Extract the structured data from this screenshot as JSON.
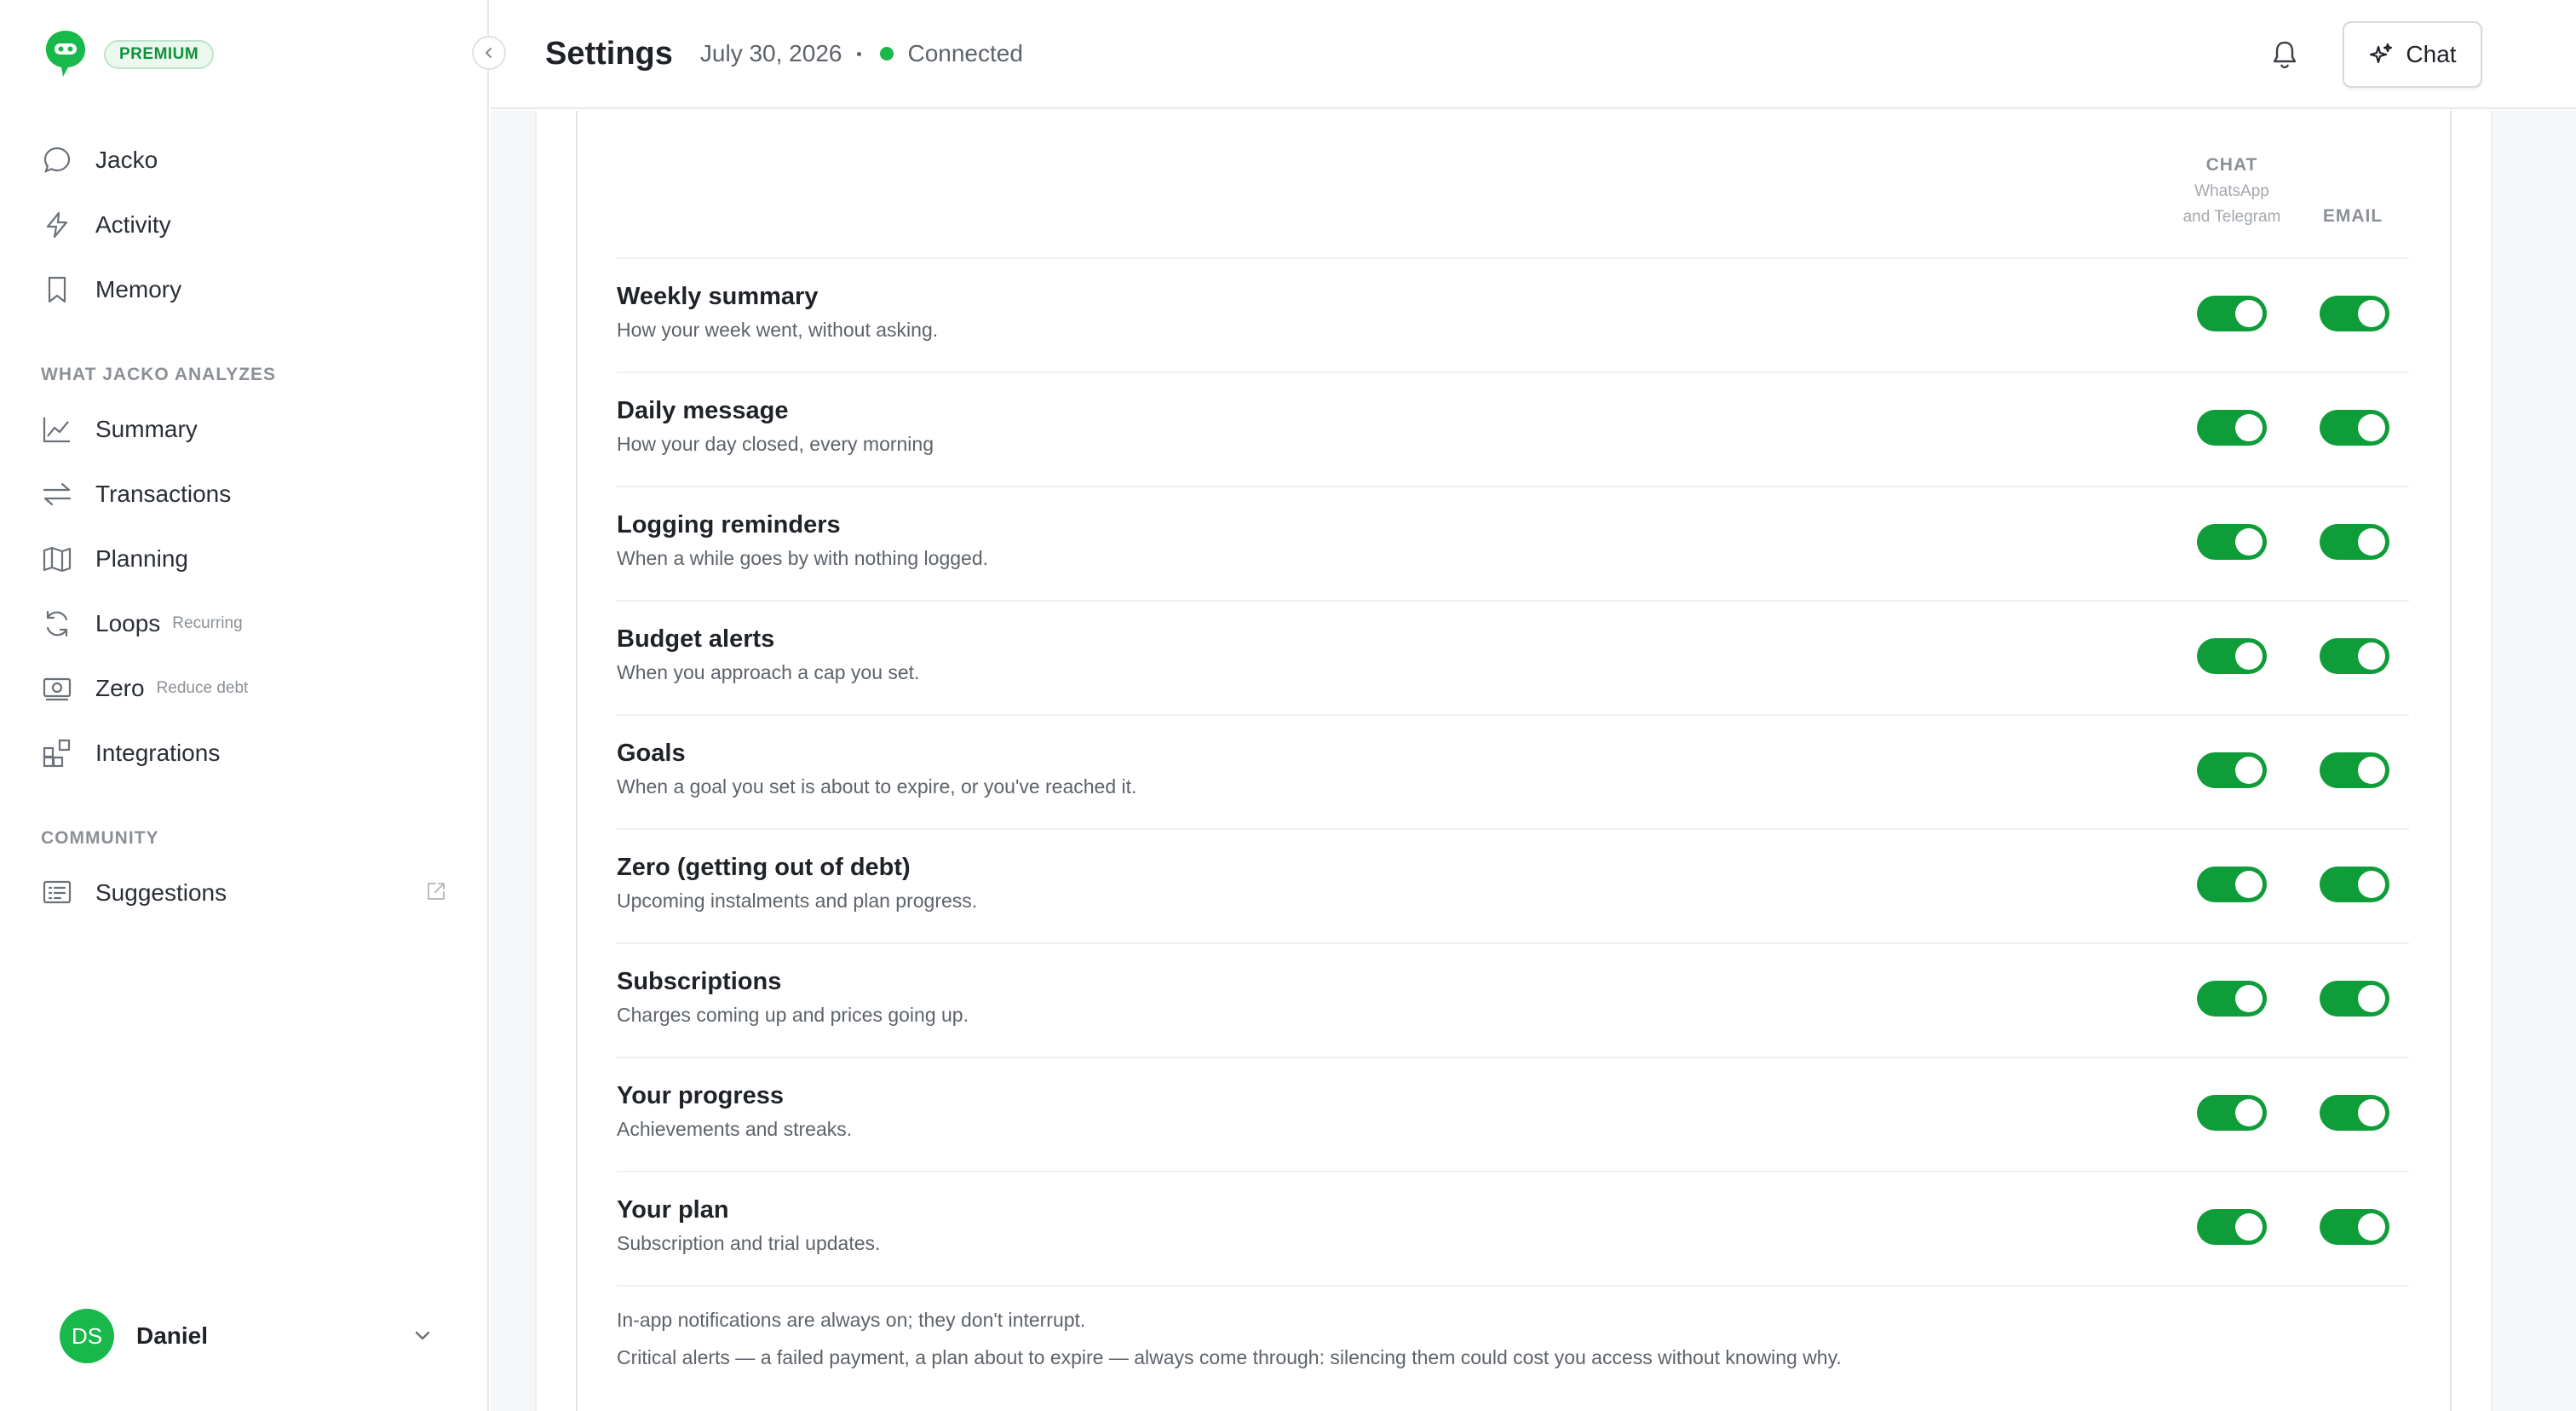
{
  "app": {
    "badge": "PREMIUM",
    "accent_color": "#0f9d3a"
  },
  "sidebar": {
    "primary": [
      {
        "label": "Jacko",
        "icon": "chat-bubble-icon"
      },
      {
        "label": "Activity",
        "icon": "lightning-icon"
      },
      {
        "label": "Memory",
        "icon": "bookmark-icon"
      }
    ],
    "section_analyzes": "WHAT JACKO ANALYZES",
    "analyzes": [
      {
        "label": "Summary",
        "sub": "",
        "icon": "line-chart-icon"
      },
      {
        "label": "Transactions",
        "sub": "",
        "icon": "arrows-swap-icon"
      },
      {
        "label": "Planning",
        "sub": "",
        "icon": "map-icon"
      },
      {
        "label": "Loops",
        "sub": "Recurring",
        "icon": "refresh-icon"
      },
      {
        "label": "Zero",
        "sub": "Reduce debt",
        "icon": "money-icon"
      },
      {
        "label": "Integrations",
        "sub": "",
        "icon": "grid-plus-icon"
      }
    ],
    "section_community": "COMMUNITY",
    "community": [
      {
        "label": "Suggestions",
        "icon": "list-card-icon"
      }
    ],
    "user": {
      "initials": "DS",
      "name": "Daniel"
    }
  },
  "header": {
    "title": "Settings",
    "date": "July 30, 2026",
    "status": "Connected",
    "chat_label": "Chat"
  },
  "notifications": {
    "columns": {
      "chat_title": "CHAT",
      "chat_sub_line1": "WhatsApp",
      "chat_sub_line2": "and Telegram",
      "email_title": "EMAIL"
    },
    "rows": [
      {
        "title": "Weekly summary",
        "desc": "How your week went, without asking.",
        "chat": true,
        "email": true
      },
      {
        "title": "Daily message",
        "desc": "How your day closed, every morning",
        "chat": true,
        "email": true
      },
      {
        "title": "Logging reminders",
        "desc": "When a while goes by with nothing logged.",
        "chat": true,
        "email": true
      },
      {
        "title": "Budget alerts",
        "desc": "When you approach a cap you set.",
        "chat": true,
        "email": true
      },
      {
        "title": "Goals",
        "desc": "When a goal you set is about to expire, or you've reached it.",
        "chat": true,
        "email": true
      },
      {
        "title": "Zero (getting out of debt)",
        "desc": "Upcoming instalments and plan progress.",
        "chat": true,
        "email": true
      },
      {
        "title": "Subscriptions",
        "desc": "Charges coming up and prices going up.",
        "chat": true,
        "email": true
      },
      {
        "title": "Your progress",
        "desc": "Achievements and streaks.",
        "chat": true,
        "email": true
      },
      {
        "title": "Your plan",
        "desc": "Subscription and trial updates.",
        "chat": true,
        "email": true
      }
    ],
    "footnote_1": "In-app notifications are always on; they don't interrupt.",
    "footnote_2": "Critical alerts — a failed payment, a plan about to expire — always come through: silencing them could cost you access without knowing why."
  }
}
